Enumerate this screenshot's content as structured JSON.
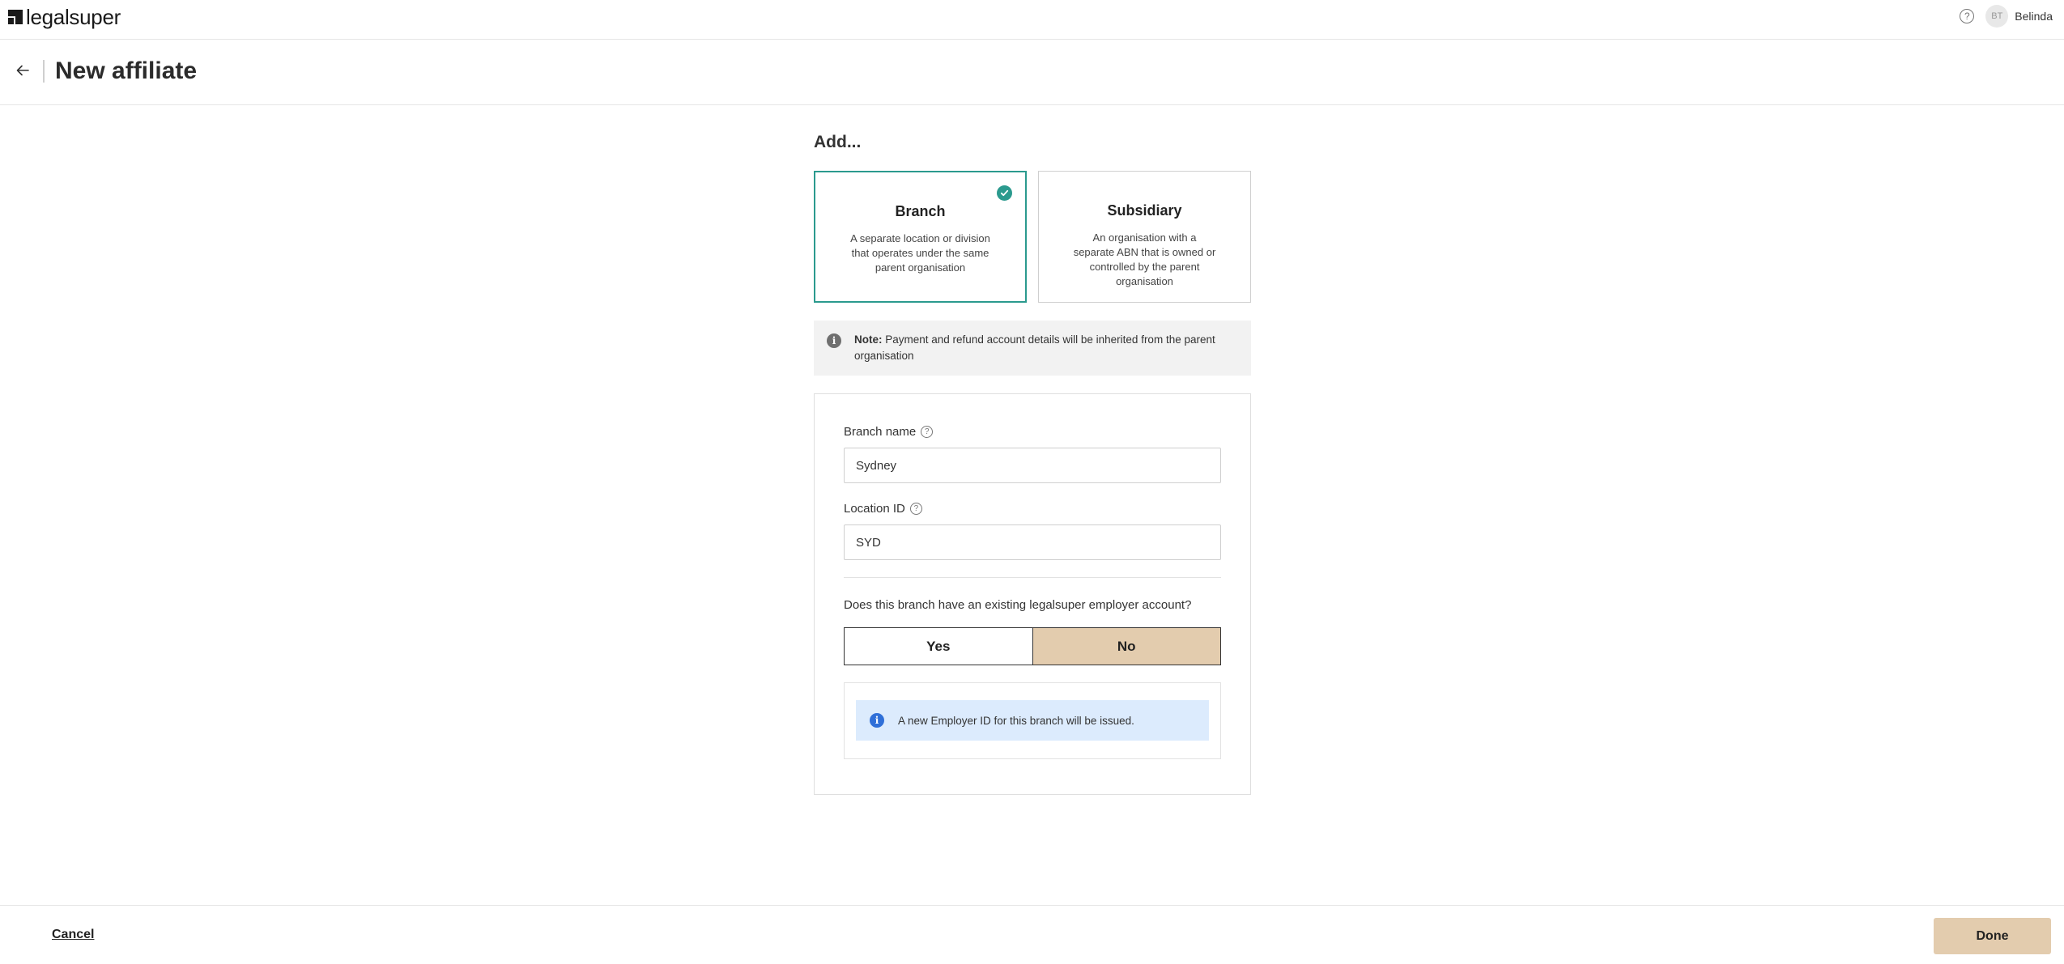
{
  "app": {
    "logo_text": "legalsuper",
    "user_initials": "BT",
    "user_name": "Belinda"
  },
  "header": {
    "title": "New affiliate"
  },
  "main": {
    "add_label": "Add...",
    "options": [
      {
        "title": "Branch",
        "description": "A separate location or division that operates under the same parent organisation",
        "selected": true
      },
      {
        "title": "Subsidiary",
        "description": "An organisation with a separate ABN that is owned or controlled by the parent organisation",
        "selected": false
      }
    ],
    "note": {
      "prefix": "Note:",
      "text": " Payment and refund account details will be inherited from the parent organisation"
    },
    "form": {
      "branch_name_label": "Branch name",
      "branch_name_value": "Sydney",
      "location_id_label": "Location ID",
      "location_id_value": "SYD",
      "question": "Does this branch have an existing legalsuper employer account?",
      "yes_label": "Yes",
      "no_label": "No",
      "selected_answer": "No",
      "info_text": "A new Employer ID for this branch will be issued."
    }
  },
  "footer": {
    "cancel_label": "Cancel",
    "done_label": "Done"
  },
  "colors": {
    "accent_teal": "#2b9a8e",
    "button_tan": "#e3ccae",
    "info_blue": "#2f6fd8",
    "info_banner_bg": "#dcebfd"
  }
}
